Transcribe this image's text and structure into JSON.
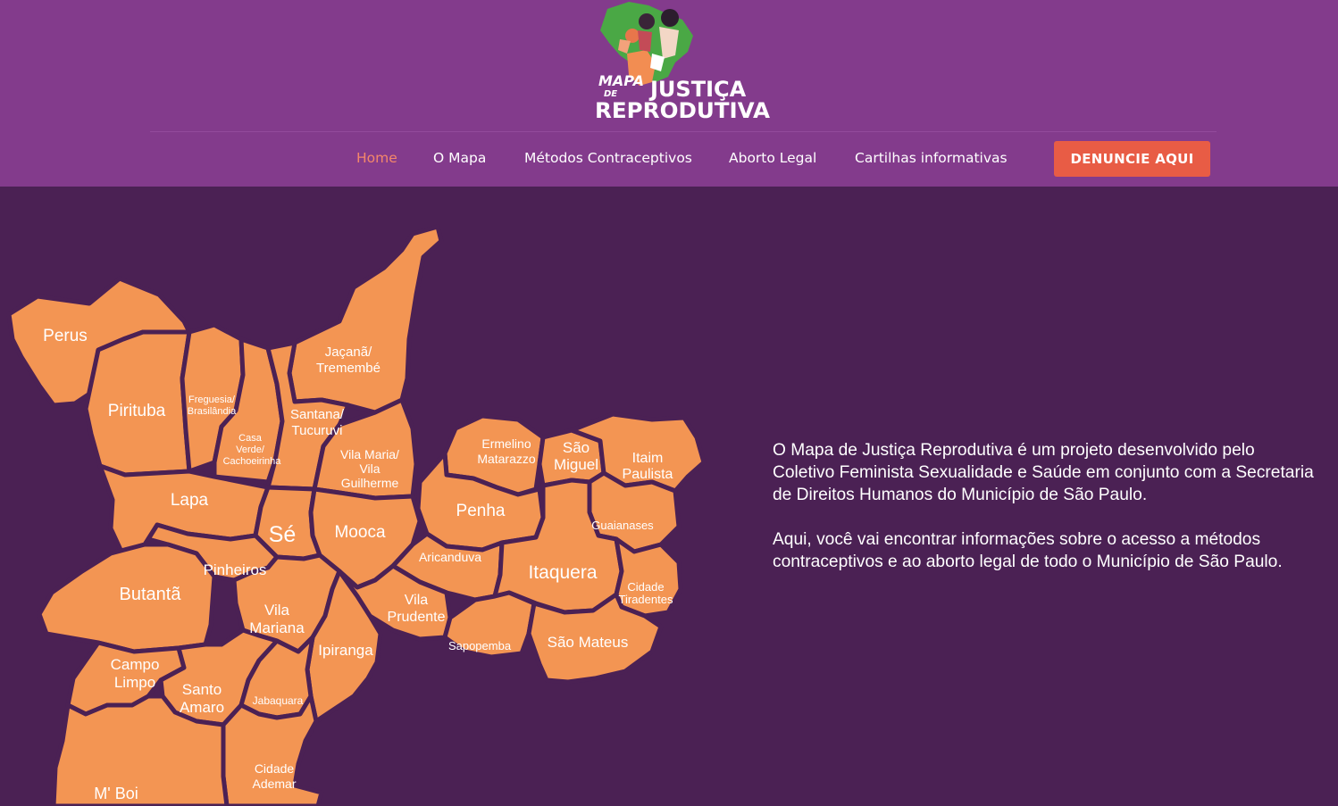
{
  "brand": {
    "logo_line1": "MAPA",
    "logo_line2": "DE",
    "logo_line3": "JUSTIÇA",
    "logo_line4": "REPRODUTIVA"
  },
  "nav": {
    "items": [
      {
        "label": "Home",
        "active": true
      },
      {
        "label": "O Mapa"
      },
      {
        "label": "Métodos Contraceptivos"
      },
      {
        "label": "Aborto Legal"
      },
      {
        "label": "Cartilhas informativas"
      }
    ],
    "cta_label": "DENUNCIE AQUI"
  },
  "map": {
    "regions": {
      "perus": "Perus",
      "pirituba": "Pirituba",
      "freguesia_1": "Freguesia/",
      "freguesia_2": "Brasilândia",
      "casa_1": "Casa",
      "casa_2": "Verde/",
      "casa_3": "Cachoeirinha",
      "jacana_1": "Jaçanã/",
      "jacana_2": "Tremembé",
      "santana_1": "Santana/",
      "santana_2": "Tucuruvi",
      "vilamaria_1": "Vila Maria/",
      "vilamaria_2": "Vila",
      "vilamaria_3": "Guilherme",
      "lapa": "Lapa",
      "se": "Sé",
      "mooca": "Mooca",
      "ermelino_1": "Ermelino",
      "ermelino_2": "Matarazzo",
      "saomiguel_1": "São",
      "saomiguel_2": "Miguel",
      "itaim_1": "Itaim",
      "itaim_2": "Paulista",
      "penha": "Penha",
      "guaianases": "Guaianases",
      "aricanduva": "Aricanduva",
      "itaquera": "Itaquera",
      "pinheiros": "Pinheiros",
      "butanta": "Butantã",
      "vilaprudente_1": "Vila",
      "vilaprudente_2": "Prudente",
      "tiradentes_1": "Cidade",
      "tiradentes_2": "Tiradentes",
      "vilamariana_1": "Vila",
      "vilamariana_2": "Mariana",
      "ipiranga": "Ipiranga",
      "sapopemba": "Sapopemba",
      "saomateus": "São Mateus",
      "campolimpo_1": "Campo",
      "campolimpo_2": "Limpo",
      "santoamaro_1": "Santo",
      "santoamaro_2": "Amaro",
      "jabaquara": "Jabaquara",
      "cidadeademar_1": "Cidade",
      "cidadeademar_2": "Ademar",
      "mboi": "M' Boi"
    }
  },
  "intro": {
    "paragraph1": "O Mapa de Justiça Reprodutiva é um projeto desenvolvido pelo Coletivo Feminista Sexualidade e Saúde em conjunto com a Secretaria de Direitos Humanos do Município de São Paulo.",
    "paragraph2": "Aqui, você vai encontrar informações sobre o acesso a métodos contraceptivos e ao aborto legal de todo o Município de São Paulo."
  }
}
